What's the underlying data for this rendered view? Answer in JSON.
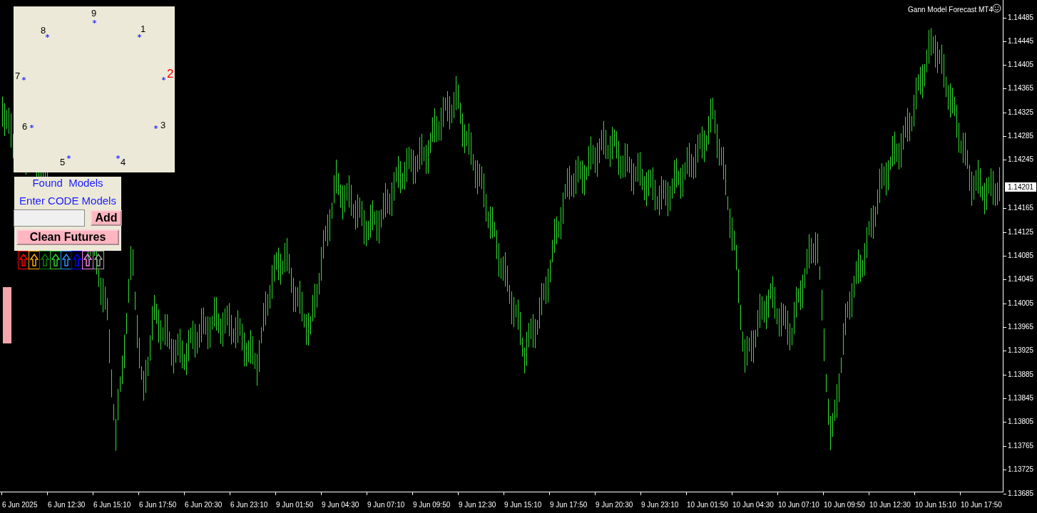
{
  "indicator_title": "Gann Model Forecast MT4",
  "dial": {
    "points": [
      {
        "label": "9",
        "highlighted": false
      },
      {
        "label": "1",
        "highlighted": false
      },
      {
        "label": "2",
        "highlighted": true
      },
      {
        "label": "3",
        "highlighted": false
      },
      {
        "label": "4",
        "highlighted": false
      },
      {
        "label": "5",
        "highlighted": false
      },
      {
        "label": "6",
        "highlighted": false
      },
      {
        "label": "7",
        "highlighted": false
      },
      {
        "label": "8",
        "highlighted": false
      }
    ]
  },
  "panel": {
    "title": "Found  Models",
    "prompt": "Enter CODE Models",
    "add_button": "Add",
    "clean_button": "Clean Futures",
    "arrows": [
      {
        "color": "#ff0000"
      },
      {
        "color": "#ffa500"
      },
      {
        "color": "#008000"
      },
      {
        "color": "#32cd32"
      },
      {
        "color": "#1e90ff"
      },
      {
        "color": "#0000ff"
      },
      {
        "color": "#ee82ee"
      },
      {
        "color": "#a0a0a0"
      }
    ]
  },
  "price_axis": [
    "1.14485",
    "1.14445",
    "1.14405",
    "1.14365",
    "1.14325",
    "1.14285",
    "1.14245",
    "1.14165",
    "1.14125",
    "1.14085",
    "1.14045",
    "1.14005",
    "1.13965",
    "1.13925",
    "1.13885",
    "1.13845",
    "1.13805",
    "1.13765",
    "1.13725",
    "1.13685"
  ],
  "current_price": "1.14201",
  "time_axis": [
    "6 Jun 2025",
    "6 Jun 12:30",
    "6 Jun 15:10",
    "6 Jun 17:50",
    "6 Jun 20:30",
    "6 Jun 23:10",
    "9 Jun 01:50",
    "9 Jun 04:30",
    "9 Jun 07:10",
    "9 Jun 09:50",
    "9 Jun 12:30",
    "9 Jun 15:10",
    "9 Jun 17:50",
    "9 Jun 20:30",
    "9 Jun 23:10",
    "10 Jun 01:50",
    "10 Jun 04:30",
    "10 Jun 07:10",
    "10 Jun 09:50",
    "10 Jun 12:30",
    "10 Jun 15:10",
    "10 Jun 17:50"
  ]
}
